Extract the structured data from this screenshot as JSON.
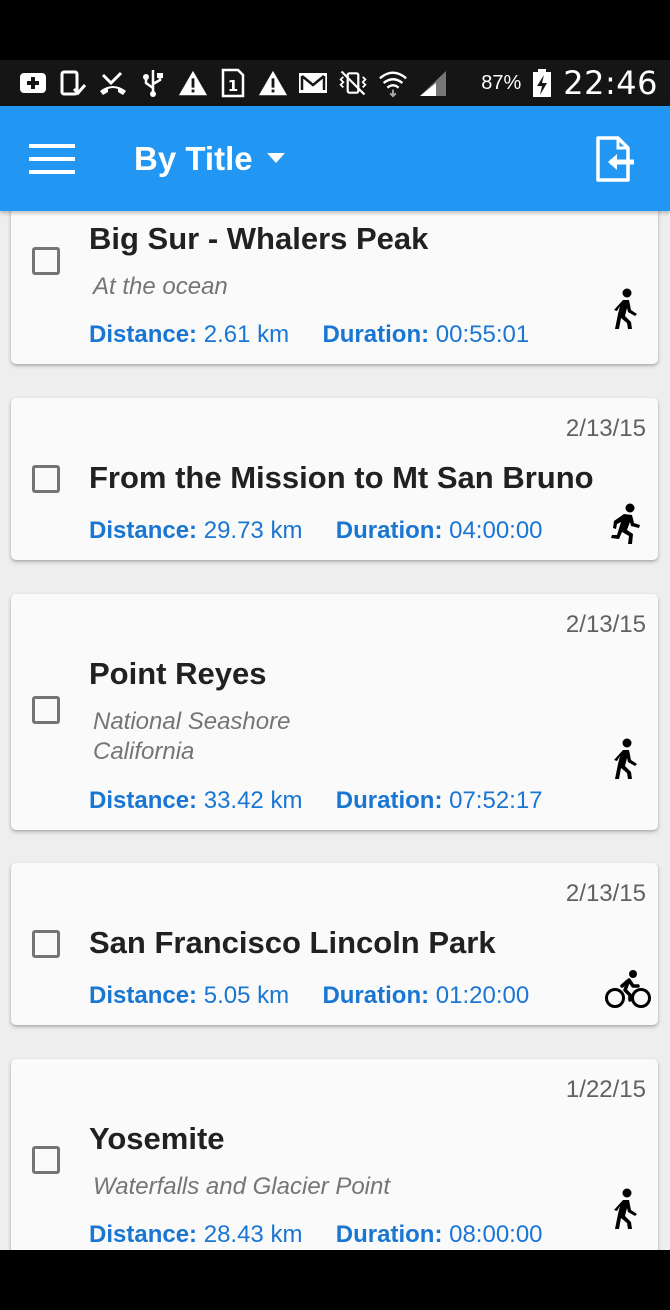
{
  "status_bar": {
    "battery_percent": "87%",
    "time": "22:46",
    "icons": [
      "add-box-icon",
      "phone-check-icon",
      "missed-call-icon",
      "usb-icon",
      "warning-icon",
      "sim-1-icon",
      "warning-icon",
      "gmail-icon",
      "vibrate-icon",
      "wifi-icon",
      "signal-icon",
      "battery-charging-icon"
    ]
  },
  "app_bar": {
    "title": "By Title",
    "menu_icon": "hamburger-menu-icon",
    "dropdown_icon": "caret-down-icon",
    "export_icon": "export-icon",
    "color": "#2196F3"
  },
  "labels": {
    "distance": "Distance:",
    "duration": "Duration:"
  },
  "tracks": [
    {
      "date": "",
      "title": "Big Sur - Whalers Peak",
      "subtitle": "At the ocean",
      "subtitle2": "",
      "distance": "2.61 km",
      "duration": "00:55:01",
      "activity": "walking-icon"
    },
    {
      "date": "2/13/15",
      "title": "From the Mission to Mt San Bruno",
      "subtitle": "",
      "subtitle2": "",
      "distance": "29.73 km",
      "duration": "04:00:00",
      "activity": "running-icon"
    },
    {
      "date": "2/13/15",
      "title": "Point Reyes",
      "subtitle": "National Seashore",
      "subtitle2": "California",
      "distance": "33.42 km",
      "duration": "07:52:17",
      "activity": "walking-icon"
    },
    {
      "date": "2/13/15",
      "title": "San Francisco Lincoln Park",
      "subtitle": "",
      "subtitle2": "",
      "distance": "5.05 km",
      "duration": "01:20:00",
      "activity": "cycling-icon"
    },
    {
      "date": "1/22/15",
      "title": "Yosemite",
      "subtitle": "Waterfalls and Glacier Point",
      "subtitle2": "",
      "distance": "28.43 km",
      "duration": "08:00:00",
      "activity": "walking-icon"
    }
  ]
}
